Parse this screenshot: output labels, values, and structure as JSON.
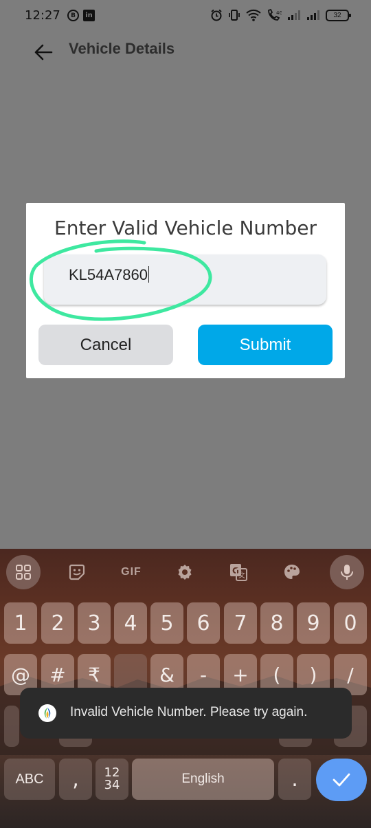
{
  "status_bar": {
    "time": "12:27",
    "left_icons": [
      "b-circle-icon",
      "linkedin-icon"
    ],
    "linkedin_glyph": "in",
    "b_glyph": "B",
    "right_icons": [
      "alarm-icon",
      "vibrate-icon",
      "wifi-icon",
      "call-icon",
      "signal-icon",
      "signal-icon"
    ],
    "battery_level": "32"
  },
  "app_bar": {
    "title": "Vehicle Details",
    "back_icon": "arrow-left-icon"
  },
  "dialog": {
    "title": "Enter Valid Vehicle Number",
    "input_value": "KL54A7860",
    "cancel_label": "Cancel",
    "submit_label": "Submit",
    "submit_color": "#00a8e8",
    "annotation_color": "#3ee8a0"
  },
  "keyboard": {
    "toolbar": [
      "apps-icon",
      "sticker-icon",
      "gif",
      "settings-icon",
      "translate-icon",
      "palette-icon",
      "mic-icon"
    ],
    "gif_label": "GIF",
    "row1": [
      "1",
      "2",
      "3",
      "4",
      "5",
      "6",
      "7",
      "8",
      "9",
      "0"
    ],
    "row2": [
      "@",
      "#",
      "₹",
      "",
      "&",
      "-",
      "+",
      "(",
      ")",
      "/"
    ],
    "bottom_row": {
      "abc_label": "ABC",
      "comma": ",",
      "numpad_top": "12",
      "numpad_bottom": "34",
      "space_label": "English",
      "period": ".",
      "enter_icon": "check-icon"
    },
    "enter_color": "#5d9cf5"
  },
  "toast": {
    "message": "Invalid Vehicle Number. Please try again.",
    "icon": "app-logo-icon"
  }
}
